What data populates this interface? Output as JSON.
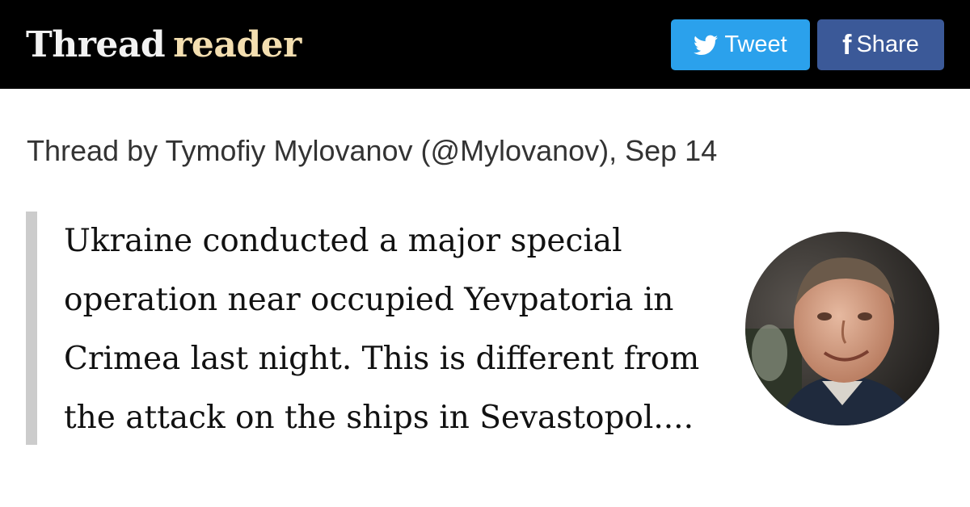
{
  "header": {
    "logo_part1": "Thread",
    "logo_part2": "reader",
    "tweet_label": "Tweet",
    "share_label": "Share",
    "tweet_icon": "twitter-bird-icon",
    "share_icon": "facebook-f-icon",
    "colors": {
      "background": "#000000",
      "logo_primary": "#f2f2f2",
      "logo_accent": "#f3deb0",
      "tweet_button": "#2ba1ec",
      "share_button": "#3b5998"
    }
  },
  "byline": "Thread by Tymofiy Mylovanov (@Mylovanov), Sep 14",
  "quote": {
    "lines": [
      "Ukraine conducted a major special",
      "operation near occupied Yevpatoria in",
      "Crimea last night. This is different from",
      "the attack on the ships in Sevastopol...."
    ]
  }
}
